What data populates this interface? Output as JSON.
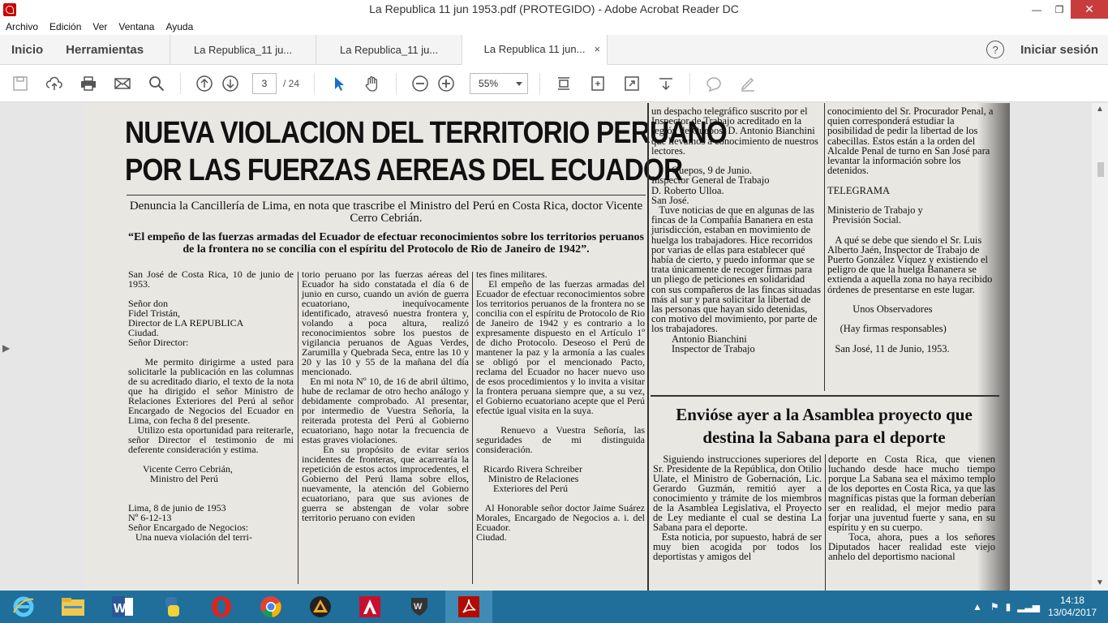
{
  "window": {
    "title": "La Republica 11 jun 1953.pdf (PROTEGIDO) - Adobe Acrobat Reader DC",
    "min": "—",
    "max": "❐",
    "close": "✕"
  },
  "menu": [
    "Archivo",
    "Edición",
    "Ver",
    "Ventana",
    "Ayuda"
  ],
  "nav": {
    "home": "Inicio",
    "tools": "Herramientas",
    "signin": "Iniciar sesión",
    "help": "?"
  },
  "tabs": [
    {
      "label": "La Republica_11 ju..."
    },
    {
      "label": "La Republica_11 ju..."
    },
    {
      "label": "La Republica 11 jun...",
      "close": "×"
    }
  ],
  "toolbar": {
    "page_current": "3",
    "page_total": "/ 24",
    "zoom": "55%"
  },
  "article": {
    "headline1": "NUEVA VIOLACION DEL TERRITORIO PERUANO",
    "headline2": "POR LAS FUERZAS AEREAS DEL ECUADOR",
    "subhead": "Denuncia la Cancillería de Lima, en nota que trascribe el Ministro del Perú en Costa Rica, doctor Vicente Cerro Cebrián.",
    "quote": "“El empeño de las fuerzas armadas del Ecuador de efectuar reconocimientos sobre los territorios peruanos de la frontera no se concilia con el espíritu del Protocolo de Rio de Janeiro de 1942”.",
    "col1": "San José de Costa Rica, 10 de junio de 1953.\n\nSeñor don\nFidel Tristán,\nDirector de LA REPUBLICA\nCiudad.\nSeñor Director:\n\n   Me permito dirigirme a usted para solicitarle la publicación en las columnas de su acreditado diario, el texto de la nota que ha dirigido el señor Ministro de Relaciones Exteriores del Perú al señor Encargado de Negocios del Ecuador en Lima, con fecha 8 del presente.\n   Utilizo esta oportunidad para reiterarle, señor Director el testimonio de mi deferente consideración y estima.\n\n      Vicente Cerro Cebrián,\n         Ministro del Perú\n\n\nLima, 8 de junio de 1953\nNº 6-12-13\nSeñor Encargado de Negocios:\n   Una nueva violación del terri-",
    "col2": "torio peruano por las fuerzas aéreas del Ecuador ha sido constatada el día 6 de junio en curso, cuando un avión de guerra ecuatoriano, inequívocamente identificado, atravesó nuestra frontera y, volando a poca altura, realizó reconocimientos sobre los puestos de vigilancia peruanos de Aguas Verdes, Zarumilla y Quebrada Seca, entre las 10 y 20 y las 10 y 55 de la mañana del día mencionado.\n   En mi nota Nº 10, de 16 de abril último, hube de reclamar de otro hecho análogo y debidamente comprobado. Al presentar, por intermedio de Vuestra Señoría, la reiterada protesta del Perú al Gobierno ecuatoriano, hago notar la frecuencia de estas graves violaciones.\n   En su propósito de evitar serios incidentes de fronteras, que acarrearía la repetición de estos actos improcedentes, el Gobierno del Perú llama sobre ellos, nuevamente, la atención del Gobierno ecuatoriano, para que sus aviones de guerra se abstengan de volar sobre territorio peruano con eviden",
    "col3": "tes fines militares.\n   El empeño de las fuerzas armadas del Ecuador de efectuar reconocimientos sobre los territorios peruanos de la frontera no se concilia con el espíritu de Protocolo de Rio de Janeiro de 1942 y es contrario a lo expresamente dispuesto en el Artículo 1º de dicho Protocolo. Deseoso el Perú de mantener la paz y la armonía a las cuales se obligó por el mencionado Pacto, reclama del Ecuador no hacer nuevo uso de esos procedimientos y lo invita a visitar la frontera peruana siempre que, a su vez, el Gobierno ecuatoriano acepte que el Perú efectúe igual visita en la suya.\n\n   Renuevo a Vuestra Señoría, las seguridades de mi distinguida consideración.\n\n   Ricardo Rivera Schreiber\n     Ministro de Relaciones\n       Exteriores del Perú\n\n   Al Honorable señor doctor Jaime Suárez Morales, Encargado de Negocios a. i. del Ecuador.\nCiudad.",
    "col4": "un despacho telegráfico suscrito por el Inspector de Trabajo acreditado en la región de Quepos, D. Antonio Bianchini que llevamos a conocimiento de nuestros lectores.\n\n        Quepos, 9 de Junio.\nInspector General de Trabajo\nD. Roberto Ulloa.\nSan José.\n   Tuve noticias de que en algunas de las fincas de la Compañía Bananera en esta jurisdicción, estaban en movimiento de huelga los trabajadores. Hice recorridos por varias de ellas para establecer qué había de cierto, y puedo informar que se trata únicamente de recoger firmas para un pliego de peticiones en solidaridad con sus compañeros de las fincas situadas más al sur y para solicitar la libertad de las personas que hayan sido detenidas, con motivo del movimiento, por parte de los trabajadores.\n        Antonio Bianchini\n        Inspector de Trabajo",
    "col5": "conocimiento del Sr. Procurador Penal, a quien corresponderá estudiar la posibilidad de pedir la libertad de los cabecillas. Estos están a la orden del Alcalde Penal de turno en San José para levantar la información sobre los detenidos.\n\nTELEGRAMA\n\nMinisterio de Trabajo y\n  Previsión Social.\n\n   A qué se debe que siendo el Sr. Luis Alberto Jaén, Inspector de Trabajo de Puerto González Víquez y existiendo el peligro de que la huelga Bananera se extienda a aquella zona no haya recibido órdenes de presentarse en este lugar.\n\n          Unos Observadores\n\n     (Hay firmas responsables)\n\n   San José, 11 de Junio, 1953.",
    "headline_b": "Envióse ayer a la Asamblea proyecto que destina la Sabana para el deporte",
    "col6": "   Siguiendo instrucciones superiores del Sr. Presidente de la República, don Otilio Ulate, el Ministro de Gobernación, Lic. Gerardo Guzmán, remitió ayer a conocimiento y trámite de los miembros de la Asamblea Legislativa, el Proyecto de Ley mediante el cual se destina La Sabana para el deporte.\n   Esta noticia, por supuesto, habrá de ser muy bien acogida por todos los deportistas y amigos del",
    "col7": "deporte en Costa Rica, que vienen luchando desde hace mucho tiempo porque La Sabana sea el máximo templo de los deportes en Costa Rica, ya que las magníficas pistas que la forman deberían ser en realidad, el mejor medio para forjar una juventud fuerte y sana, en su espíritu y en su cuerpo.\n   Toca, ahora, pues a los señores Diputados hacer realidad este viejo anhelo del deportismo nacional"
  },
  "taskbar": {
    "time": "14:18",
    "date": "13/04/2017"
  }
}
